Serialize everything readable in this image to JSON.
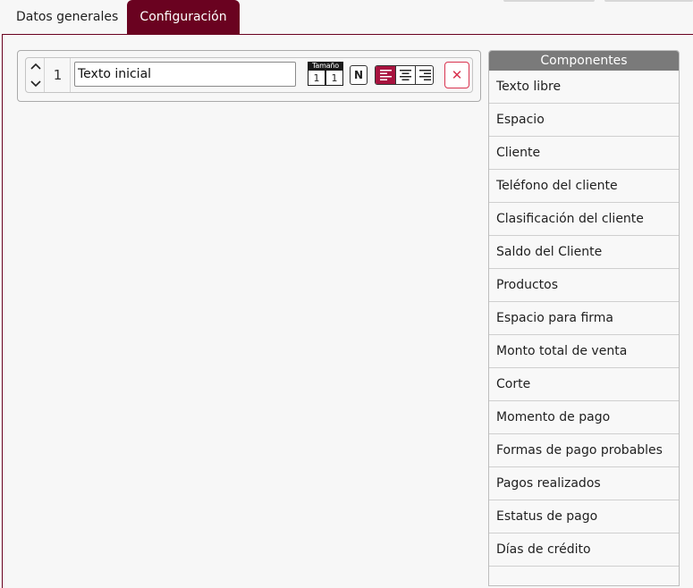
{
  "tabs": [
    {
      "label": "Datos generales",
      "active": false
    },
    {
      "label": "Configuración",
      "active": true
    }
  ],
  "colors": {
    "accent": "#6a0220",
    "active_align": "#a8133f",
    "delete": "#d9334f",
    "components_header": "#7a7a7a"
  },
  "editor": {
    "row": {
      "index": "1",
      "text_value": "Texto inicial",
      "size_label": "Tamaño",
      "size_a": "1",
      "size_b": "1",
      "bold_label": "N",
      "alignment": "left",
      "delete_label": "✕",
      "icons": {
        "up": "chevron-up-icon",
        "down": "chevron-down-icon",
        "align_left": "align-left-icon",
        "align_center": "align-center-icon",
        "align_right": "align-right-icon",
        "delete": "close-icon"
      }
    }
  },
  "components": {
    "title": "Componentes",
    "items": [
      "Texto libre",
      "Espacio",
      "Cliente",
      "Teléfono del cliente",
      "Clasificación del cliente",
      "Saldo del Cliente",
      "Productos",
      "Espacio para firma",
      "Monto total de venta",
      "Corte",
      "Momento de pago",
      "Formas de pago probables",
      "Pagos realizados",
      "Estatus de pago",
      "Días de crédito",
      ""
    ]
  }
}
